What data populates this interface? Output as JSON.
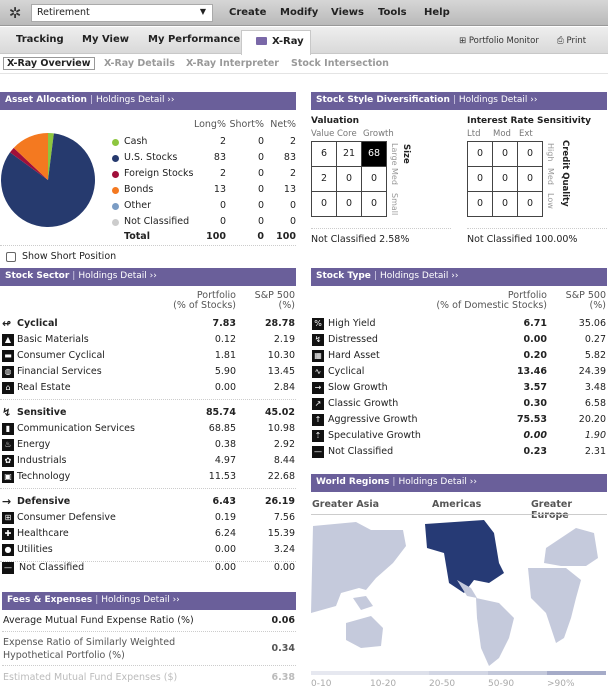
{
  "topbar": {
    "portfolio_selected": "Retirement",
    "menus": [
      "Create",
      "Modify",
      "Views",
      "Tools",
      "Help"
    ]
  },
  "tabs": {
    "items": [
      "Tracking",
      "My View",
      "My Performance"
    ],
    "active": "X-Ray",
    "portfolio_monitor": "Portfolio Monitor",
    "print": "Print"
  },
  "subnav": [
    "X-Ray Overview",
    "X-Ray Details",
    "X-Ray Interpreter",
    "Stock Intersection"
  ],
  "asset_allocation": {
    "title": "Asset Allocation",
    "link": "Holdings Detail ››",
    "columns": [
      "Long%",
      "Short%",
      "Net%"
    ],
    "rows": [
      {
        "label": "Cash",
        "color": "#8dc63f",
        "long": "2",
        "short": "0",
        "net": "2"
      },
      {
        "label": "U.S. Stocks",
        "color": "#263a6e",
        "long": "83",
        "short": "0",
        "net": "83"
      },
      {
        "label": "Foreign Stocks",
        "color": "#a0103a",
        "long": "2",
        "short": "0",
        "net": "2"
      },
      {
        "label": "Bonds",
        "color": "#f47920",
        "long": "13",
        "short": "0",
        "net": "13"
      },
      {
        "label": "Other",
        "color": "#7b9cc4",
        "long": "0",
        "short": "0",
        "net": "0"
      },
      {
        "label": "Not Classified",
        "color": "#cccccc",
        "long": "0",
        "short": "0",
        "net": "0"
      }
    ],
    "total": {
      "label": "Total",
      "long": "100",
      "short": "0",
      "net": "100"
    },
    "show_short": "Show Short Position"
  },
  "style": {
    "title": "Stock Style Diversification",
    "link": "Holdings Detail ››",
    "valuation": {
      "title": "Valuation",
      "cols": [
        "Value",
        "Core",
        "Growth"
      ],
      "rows_label": [
        "Large",
        "Med",
        "Small"
      ],
      "axis": "Size",
      "grid": [
        [
          "6",
          "21",
          "68"
        ],
        [
          "2",
          "0",
          "0"
        ],
        [
          "0",
          "0",
          "0"
        ]
      ],
      "not_classified": "Not Classified 2.58%"
    },
    "interest": {
      "title": "Interest Rate Sensitivity",
      "cols": [
        "Ltd",
        "Mod",
        "Ext"
      ],
      "rows_label": [
        "High",
        "Med",
        "Low"
      ],
      "axis": "Credit Quality",
      "grid": [
        [
          "0",
          "0",
          "0"
        ],
        [
          "0",
          "0",
          "0"
        ],
        [
          "0",
          "0",
          "0"
        ]
      ],
      "not_classified": "Not Classified 100.00%"
    }
  },
  "sector": {
    "title": "Stock Sector",
    "link": "Holdings Detail ››",
    "col1": [
      "Portfolio",
      "(% of Stocks)"
    ],
    "col2": [
      "S&P 500",
      "(%)"
    ],
    "groups": [
      {
        "label": "Cyclical",
        "p": "7.83",
        "s": "28.78",
        "items": [
          {
            "label": "Basic Materials",
            "p": "0.12",
            "s": "2.19"
          },
          {
            "label": "Consumer Cyclical",
            "p": "1.81",
            "s": "10.30"
          },
          {
            "label": "Financial Services",
            "p": "5.90",
            "s": "13.45"
          },
          {
            "label": "Real Estate",
            "p": "0.00",
            "s": "2.84"
          }
        ]
      },
      {
        "label": "Sensitive",
        "p": "85.74",
        "s": "45.02",
        "items": [
          {
            "label": "Communication Services",
            "p": "68.85",
            "s": "10.98"
          },
          {
            "label": "Energy",
            "p": "0.38",
            "s": "2.92"
          },
          {
            "label": "Industrials",
            "p": "4.97",
            "s": "8.44"
          },
          {
            "label": "Technology",
            "p": "11.53",
            "s": "22.68"
          }
        ]
      },
      {
        "label": "Defensive",
        "p": "6.43",
        "s": "26.19",
        "items": [
          {
            "label": "Consumer Defensive",
            "p": "0.19",
            "s": "7.56"
          },
          {
            "label": "Healthcare",
            "p": "6.24",
            "s": "15.39"
          },
          {
            "label": "Utilities",
            "p": "0.00",
            "s": "3.24"
          }
        ]
      }
    ],
    "not_classified": {
      "label": "Not Classified",
      "p": "0.00",
      "s": "0.00"
    }
  },
  "stock_type": {
    "title": "Stock Type",
    "link": "Holdings Detail ››",
    "col1": [
      "Portfolio",
      "(% of Domestic Stocks)"
    ],
    "col2": [
      "S&P 500",
      "(%)"
    ],
    "rows": [
      {
        "label": "High Yield",
        "p": "6.71",
        "s": "35.06",
        "icon": "%"
      },
      {
        "label": "Distressed",
        "p": "0.00",
        "s": "0.27",
        "icon": "↯"
      },
      {
        "label": "Hard Asset",
        "p": "0.20",
        "s": "5.82",
        "icon": "▦"
      },
      {
        "label": "Cyclical",
        "p": "13.46",
        "s": "24.39",
        "icon": "∿"
      },
      {
        "label": "Slow Growth",
        "p": "3.57",
        "s": "3.48",
        "icon": "→"
      },
      {
        "label": "Classic Growth",
        "p": "0.30",
        "s": "6.58",
        "icon": "↗"
      },
      {
        "label": "Aggressive Growth",
        "p": "75.53",
        "s": "20.20",
        "icon": "↑"
      },
      {
        "label": "Speculative Growth",
        "p": "0.00",
        "s": "1.90",
        "icon": "⇡"
      },
      {
        "label": "Not Classified",
        "p": "0.23",
        "s": "2.31",
        "icon": "—"
      }
    ]
  },
  "fees": {
    "title": "Fees & Expenses",
    "link": "Holdings Detail ››",
    "rows": [
      {
        "label": "Average Mutual Fund Expense Ratio (%)",
        "value": "0.06"
      },
      {
        "label": "Expense Ratio of Similarly Weighted",
        "label2": "Hypothetical Portfolio (%)",
        "value": "0.34"
      },
      {
        "label": "Estimated Mutual Fund Expenses ($)",
        "value": "6.38"
      }
    ]
  },
  "world": {
    "title": "World Regions",
    "link": "Holdings Detail ››",
    "regions": [
      "Greater Asia",
      "Americas",
      "Greater Europe"
    ],
    "legend": [
      "0-10",
      "10-20",
      "20-50",
      "50-90",
      ">90%"
    ],
    "legend_colors": [
      "#e6e8f0",
      "#dde0ea",
      "#d2d6e4",
      "#c3c8da",
      "#a5abc8"
    ],
    "highlight_color": "#263a75",
    "base_color": "#c5cadc"
  },
  "chart_data": {
    "type": "pie",
    "title": "Asset Allocation",
    "categories": [
      "Cash",
      "U.S. Stocks",
      "Foreign Stocks",
      "Bonds",
      "Other",
      "Not Classified"
    ],
    "values": [
      2,
      83,
      2,
      13,
      0,
      0
    ],
    "colors": [
      "#8dc63f",
      "#263a6e",
      "#a0103a",
      "#f47920",
      "#7b9cc4",
      "#cccccc"
    ]
  }
}
